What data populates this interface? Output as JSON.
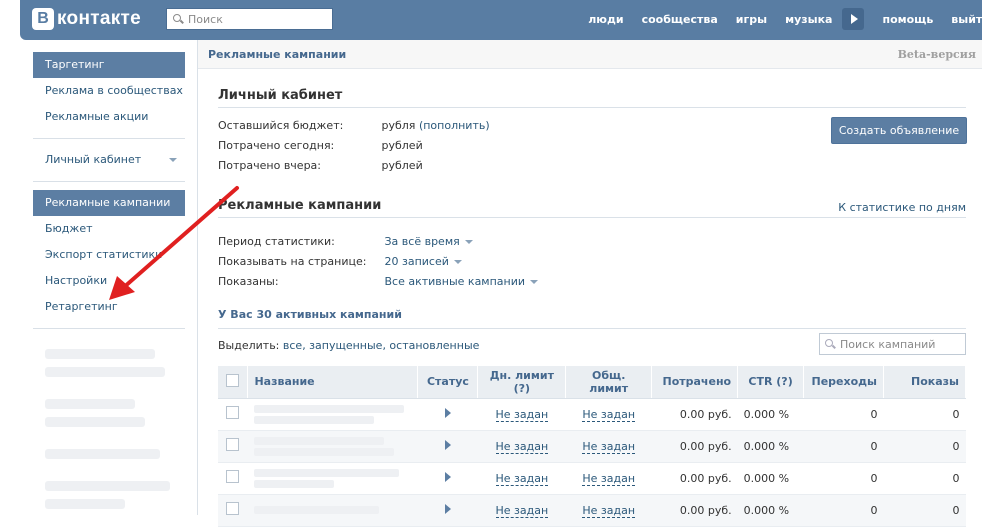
{
  "brand": {
    "logo_letter": "В",
    "logo_text": "контакте"
  },
  "top": {
    "search_placeholder": "Поиск",
    "nav": [
      "люди",
      "сообщества",
      "игры",
      "музыка",
      "помощь",
      "выйти"
    ]
  },
  "sidebar": {
    "group1": [
      "Таргетинг",
      "Реклама в сообществах",
      "Рекламные акции"
    ],
    "cabinet": "Личный кабинет",
    "group2": [
      "Рекламные кампании",
      "Бюджет",
      "Экспорт статистики",
      "Настройки",
      "Ретаргетинг"
    ]
  },
  "main": {
    "header_title": "Рекламные кампании",
    "beta": "Beta-версия",
    "cabinet_title": "Личный кабинет",
    "budget_label": "Оставшийся бюджет:",
    "budget_value": "рубля",
    "budget_link": "(пополнить)",
    "today_label": "Потрачено сегодня:",
    "today_value": "рублей",
    "yesterday_label": "Потрачено вчера:",
    "yesterday_value": "рублей",
    "create_button": "Создать объявление",
    "campaigns_title": "Рекламные кампании",
    "stats_link": "К статистике по дням",
    "filters": [
      {
        "label": "Период статистики:",
        "value": "За всё время"
      },
      {
        "label": "Показывать на странице:",
        "value": "20 записей"
      },
      {
        "label": "Показаны:",
        "value": "Все активные кампании"
      }
    ],
    "count_title": "У Вас 30 активных кампаний",
    "select_label": "Выделить:",
    "select_options": "все, запущенные, остановленные",
    "campaign_search_placeholder": "Поиск кампаний",
    "columns": [
      "Название",
      "Статус",
      "Дн. лимит (?)",
      "Общ. лимит",
      "Потрачено",
      "CTR (?)",
      "Переходы",
      "Показы"
    ],
    "rows": [
      {
        "day_limit": "Не задан",
        "total_limit": "Не задан",
        "spent": "0.00 руб.",
        "ctr": "0.000 %",
        "clicks": "0",
        "views": "0"
      },
      {
        "day_limit": "Не задан",
        "total_limit": "Не задан",
        "spent": "0.00 руб.",
        "ctr": "0.000 %",
        "clicks": "0",
        "views": "0"
      },
      {
        "day_limit": "Не задан",
        "total_limit": "Не задан",
        "spent": "0.00 руб.",
        "ctr": "0.000 %",
        "clicks": "0",
        "views": "0"
      },
      {
        "day_limit": "Не задан",
        "total_limit": "Не задан",
        "spent": "0.00 руб.",
        "ctr": "0.000 %",
        "clicks": "0",
        "views": "0"
      }
    ]
  },
  "colors": {
    "header": "#597da3",
    "active": "#5c7ea3",
    "link": "#2b587a",
    "arrow": "#e02020"
  }
}
